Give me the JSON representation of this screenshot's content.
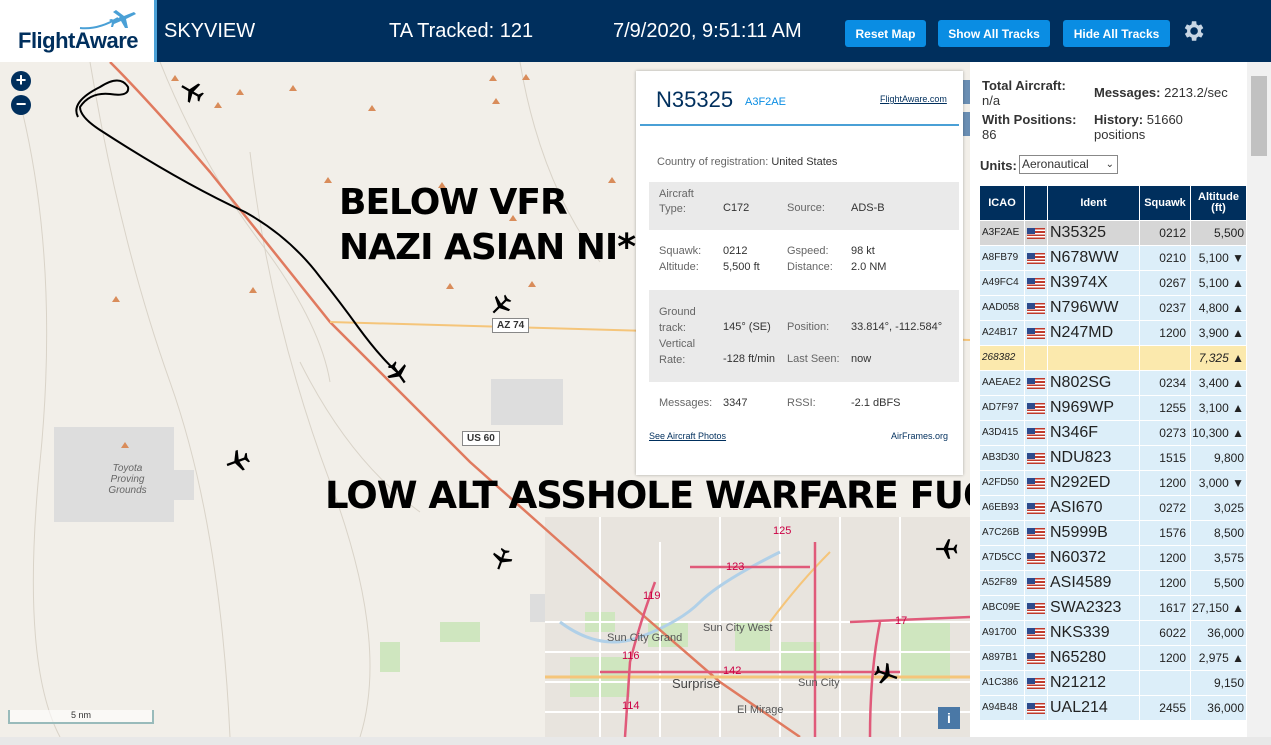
{
  "header": {
    "logo_text": "FlightAware",
    "app_title": "SKYVIEW",
    "ta_tracked": "TA Tracked: 121",
    "datetime": "7/9/2020, 9:51:11 AM",
    "btn_reset": "Reset Map",
    "btn_show": "Show All Tracks",
    "btn_hide": "Hide All Tracks"
  },
  "map": {
    "zoom_in": "+",
    "zoom_out": "−",
    "scale": "5 nm",
    "info": "i",
    "labels": {
      "toyota": "Toyota Proving Grounds",
      "sun_city_grand": "Sun City Grand",
      "sun_city_west": "Sun City West",
      "surprise": "Surprise",
      "sun_city": "Sun City",
      "el_mirage": "El Mirage",
      "az74": "AZ 74",
      "us60": "US 60",
      "r119": "119",
      "r116": "116",
      "r114": "114",
      "r142": "142",
      "r123": "123",
      "r125": "125",
      "r17": "17"
    },
    "overlay_1a": "BELOW VFR",
    "overlay_1b": "NAZI ASIAN NI*****",
    "overlay_2": "LOW ALT ASSHOLE WARFARE FUCKER"
  },
  "popup": {
    "ident": "N35325",
    "icao": "A3F2AE",
    "fa_link": "FlightAware.com",
    "country_label": "Country of registration:",
    "country": "United States",
    "aircraft_type_label": "Aircraft Type:",
    "aircraft_type_label_1": "Aircraft",
    "aircraft_type_label_2": "Type:",
    "aircraft_type": "C172",
    "source_label": "Source:",
    "source": "ADS-B",
    "squawk_label": "Squawk:",
    "squawk": "0212",
    "gspeed_label": "Gspeed:",
    "gspeed": "98 kt",
    "altitude_label": "Altitude:",
    "altitude": "5,500 ft",
    "distance_label": "Distance:",
    "distance": "2.0 NM",
    "ground_track_label_1": "Ground",
    "ground_track_label_2": "track:",
    "ground_track": "145° (SE)",
    "position_label": "Position:",
    "position": "33.814°, -112.584°",
    "vrate_label_1": "Vertical",
    "vrate_label_2": "Rate:",
    "vrate": "-128 ft/min",
    "lastseen_label": "Last Seen:",
    "lastseen": "now",
    "messages_label": "Messages:",
    "messages": "3347",
    "rssi_label": "RSSI:",
    "rssi": "-2.1 dBFS",
    "photos_link": "See Aircraft Photos",
    "airframes_link": "AirFrames.org"
  },
  "panel": {
    "total_label": "Total Aircraft:",
    "total": "n/a",
    "messages_label": "Messages:",
    "messages": "2213.2/sec",
    "withpos_label": "With Positions:",
    "withpos": "86",
    "history_label": "History:",
    "history": "51660",
    "history_unit": "positions",
    "units_label": "Units:",
    "units_value": "Aeronautical",
    "columns": {
      "icao": "ICAO",
      "ident": "Ident",
      "squawk": "Squawk",
      "altitude": "Altitude",
      "altitude_unit": "(ft)"
    },
    "rows": [
      {
        "icao": "A3F2AE",
        "ident": "N35325",
        "squawk": "0212",
        "alt": "5,500"
      },
      {
        "icao": "A8FB79",
        "ident": "N678WW",
        "squawk": "0210",
        "alt": "5,100 ▼"
      },
      {
        "icao": "A49FC4",
        "ident": "N3974X",
        "squawk": "0267",
        "alt": "5,100 ▲"
      },
      {
        "icao": "AAD058",
        "ident": "N796WW",
        "squawk": "0237",
        "alt": "4,800 ▲"
      },
      {
        "icao": "A24B17",
        "ident": "N247MD",
        "squawk": "1200",
        "alt": "3,900 ▲"
      },
      {
        "icao": "268382",
        "ident": "",
        "squawk": "",
        "alt": "7,325 ▲"
      },
      {
        "icao": "AAEAE2",
        "ident": "N802SG",
        "squawk": "0234",
        "alt": "3,400 ▲"
      },
      {
        "icao": "AD7F97",
        "ident": "N969WP",
        "squawk": "1255",
        "alt": "3,100 ▲"
      },
      {
        "icao": "A3D415",
        "ident": "N346F",
        "squawk": "0273",
        "alt": "10,300 ▲"
      },
      {
        "icao": "AB3D30",
        "ident": "NDU823",
        "squawk": "1515",
        "alt": "9,800"
      },
      {
        "icao": "A2FD50",
        "ident": "N292ED",
        "squawk": "1200",
        "alt": "3,000 ▼"
      },
      {
        "icao": "A6EB93",
        "ident": "ASI670",
        "squawk": "0272",
        "alt": "3,025"
      },
      {
        "icao": "A7C26B",
        "ident": "N5999B",
        "squawk": "1576",
        "alt": "8,500"
      },
      {
        "icao": "A7D5CC",
        "ident": "N60372",
        "squawk": "1200",
        "alt": "3,575"
      },
      {
        "icao": "A52F89",
        "ident": "ASI4589",
        "squawk": "1200",
        "alt": "5,500"
      },
      {
        "icao": "ABC09E",
        "ident": "SWA2323",
        "squawk": "1617",
        "alt": "27,150 ▲"
      },
      {
        "icao": "A91700",
        "ident": "NKS339",
        "squawk": "6022",
        "alt": "36,000"
      },
      {
        "icao": "A897B1",
        "ident": "N65280",
        "squawk": "1200",
        "alt": "2,975 ▲"
      },
      {
        "icao": "A1C386",
        "ident": "N21212",
        "squawk": "",
        "alt": "9,150"
      },
      {
        "icao": "A94B48",
        "ident": "UAL214",
        "squawk": "2455",
        "alt": "36,000"
      }
    ]
  },
  "colors": {
    "header_bg": "#002f5d",
    "button": "#0a8de3",
    "row_bg": "#dceef9",
    "row_selected": "#d6d6d6",
    "row_highlight": "#fbe9ad"
  }
}
